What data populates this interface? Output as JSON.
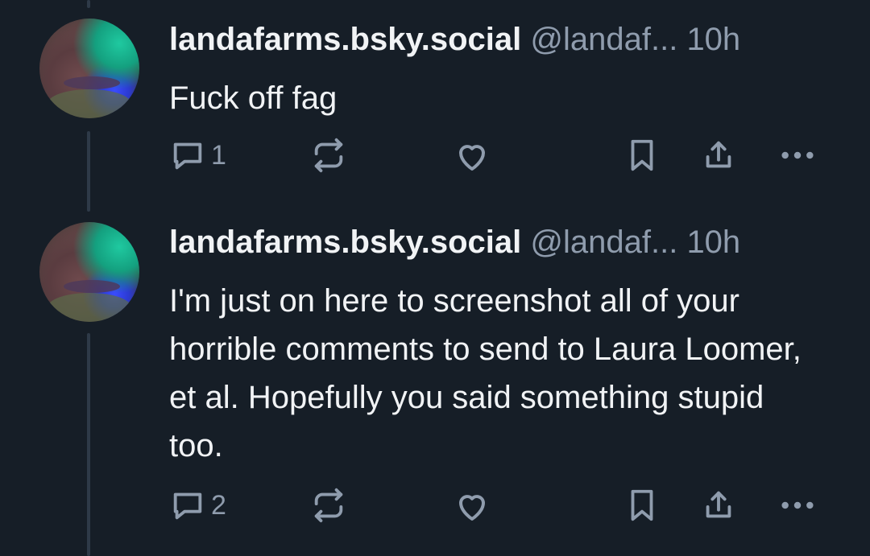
{
  "colors": {
    "background": "#161e27",
    "text": "#f1f3f5",
    "muted": "#8f9cad",
    "thread_line": "#2e3a48"
  },
  "posts": [
    {
      "display_name": "landafarms.bsky.social",
      "handle": "@landaf...",
      "time": "10h",
      "text": "Fuck off fag",
      "reply_count": "1",
      "avatar": "fish-photo-avatar"
    },
    {
      "display_name": "landafarms.bsky.social",
      "handle": "@landaf...",
      "time": "10h",
      "text": "I'm just on here to screenshot all of your horrible comments to send to Laura Loomer, et al. Hopefully you said something stupid too.",
      "reply_count": "2",
      "avatar": "fish-photo-avatar"
    }
  ],
  "icons": [
    "reply-icon",
    "repost-icon",
    "like-icon",
    "bookmark-icon",
    "share-icon",
    "more-icon"
  ]
}
